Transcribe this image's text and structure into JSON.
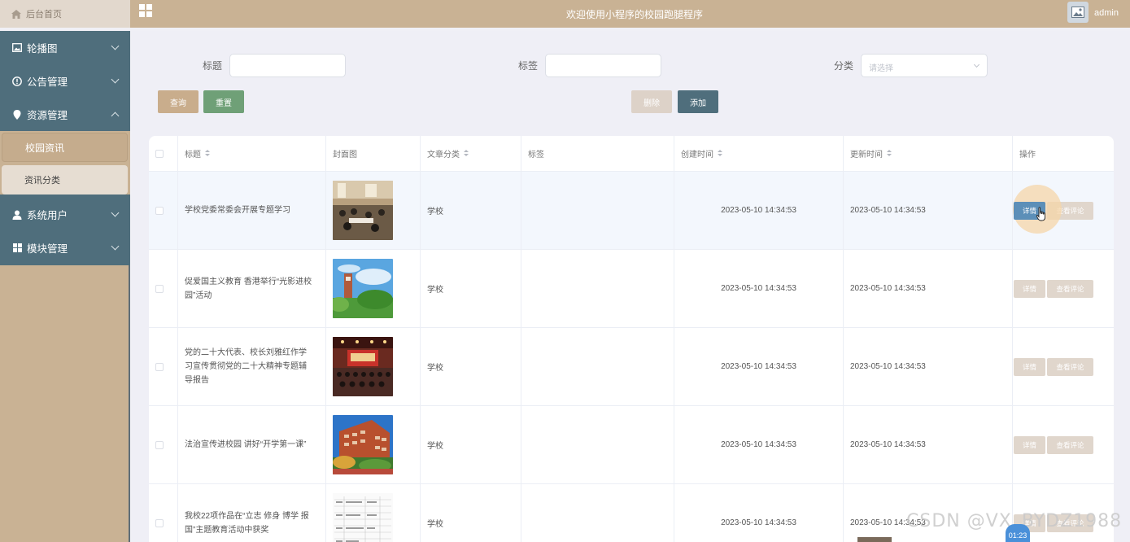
{
  "header": {
    "home_label": "后台首页",
    "title": "欢迎使用小程序的校园跑腿程序",
    "user": "admin"
  },
  "sidebar": {
    "items": [
      {
        "label": "轮播图",
        "icon": "image-icon",
        "expanded": false
      },
      {
        "label": "公告管理",
        "icon": "info-circle-icon",
        "expanded": false
      },
      {
        "label": "资源管理",
        "icon": "location-pin-icon",
        "expanded": true
      },
      {
        "label": "系统用户",
        "icon": "user-icon",
        "expanded": false
      },
      {
        "label": "模块管理",
        "icon": "grid-icon",
        "expanded": false
      }
    ],
    "subitems": [
      {
        "label": "校园资讯",
        "active": true
      },
      {
        "label": "资讯分类",
        "active": false
      }
    ]
  },
  "search": {
    "title_label": "标题",
    "tag_label": "标签",
    "category_label": "分类",
    "category_placeholder": "请选择",
    "query_label": "查询",
    "reset_label": "重置",
    "delete_label": "删除",
    "add_label": "添加"
  },
  "colors": {
    "query": "#c9ad8c",
    "reset": "#6fa077",
    "delete": "#ddd2c8",
    "add": "#4f6e7c"
  },
  "table": {
    "columns": [
      "标题",
      "封面图",
      "文章分类",
      "标签",
      "创建时间",
      "更新时间",
      "操作"
    ],
    "detail_label": "详情",
    "comment_label": "查看评论",
    "rows": [
      {
        "title": "学校党委常委会开展专题学习",
        "category": "学校",
        "tag": "",
        "created": "2023-05-10 14:34:53",
        "updated": "2023-05-10 14:34:53"
      },
      {
        "title": "促爱国主义教育 香港举行“光影进校园”活动",
        "category": "学校",
        "tag": "",
        "created": "2023-05-10 14:34:53",
        "updated": "2023-05-10 14:34:53"
      },
      {
        "title": "党的二十大代表、校长刘雅红作学习宣传贯彻党的二十大精神专题辅导报告",
        "category": "学校",
        "tag": "",
        "created": "2023-05-10 14:34:53",
        "updated": "2023-05-10 14:34:53"
      },
      {
        "title": "法治宣传进校园 讲好“开学第一课”",
        "category": "学校",
        "tag": "",
        "created": "2023-05-10 14:34:53",
        "updated": "2023-05-10 14:34:53"
      },
      {
        "title": "我校22项作品在“立志 修身 博学 报国”主题教育活动中获奖",
        "category": "学校",
        "tag": "",
        "created": "2023-05-10 14:34:53",
        "updated": "2023-05-10 14:34:53"
      }
    ]
  },
  "overlay": {
    "watermark": "CSDN @VX_BYDZ1988",
    "timer": "01:23"
  }
}
